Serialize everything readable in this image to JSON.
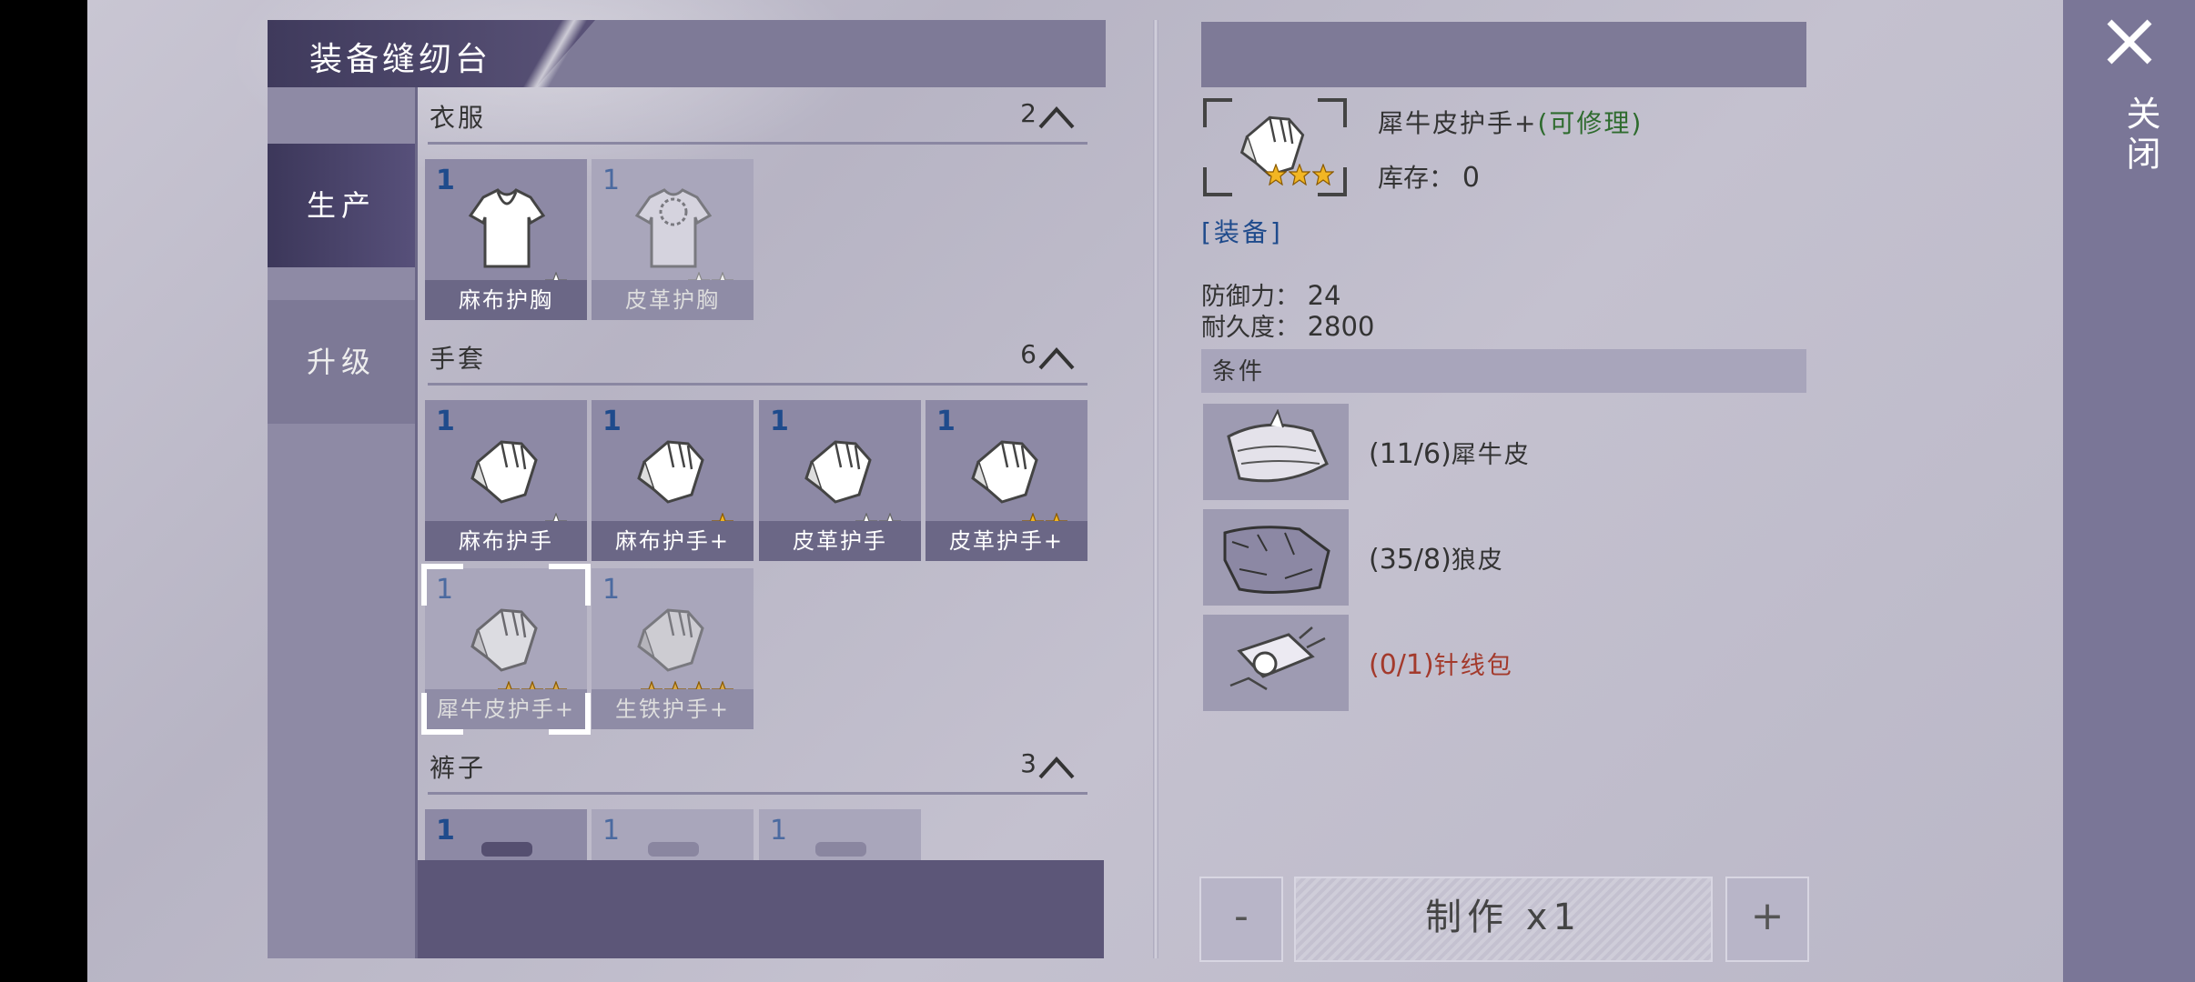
{
  "window": {
    "title": "装备缝纫台",
    "close_label": "关闭"
  },
  "side_tabs": [
    {
      "label": "生产",
      "active": true
    },
    {
      "label": "升级",
      "active": false
    }
  ],
  "categories": [
    {
      "name": "衣服",
      "count": "2",
      "items": [
        {
          "num": "1",
          "label": "麻布护胸",
          "stars": 1,
          "star_color": "white",
          "icon": "shirt-icon",
          "available": true
        },
        {
          "num": "1",
          "label": "皮革护胸",
          "stars": 2,
          "star_color": "white",
          "icon": "shirt-icon",
          "available": false
        }
      ]
    },
    {
      "name": "手套",
      "count": "6",
      "items": [
        {
          "num": "1",
          "label": "麻布护手",
          "stars": 1,
          "star_color": "white",
          "icon": "glove-icon",
          "available": true
        },
        {
          "num": "1",
          "label": "麻布护手+",
          "stars": 1,
          "star_color": "gold",
          "icon": "glove-icon",
          "available": true
        },
        {
          "num": "1",
          "label": "皮革护手",
          "stars": 2,
          "star_color": "white",
          "icon": "glove-icon",
          "available": true
        },
        {
          "num": "1",
          "label": "皮革护手+",
          "stars": 2,
          "star_color": "gold",
          "icon": "glove-icon",
          "available": true
        },
        {
          "num": "1",
          "label": "犀牛皮护手+",
          "stars": 3,
          "star_color": "gold",
          "icon": "glove-icon",
          "available": false,
          "selected": true
        },
        {
          "num": "1",
          "label": "生铁护手+",
          "stars": 4,
          "star_color": "gold",
          "icon": "glove-icon",
          "available": false
        }
      ]
    },
    {
      "name": "裤子",
      "count": "3",
      "items": [
        {
          "num": "1",
          "icon": "pants-icon",
          "available": true
        },
        {
          "num": "1",
          "icon": "pants-icon",
          "available": false
        },
        {
          "num": "1",
          "icon": "pants-icon",
          "available": false
        }
      ]
    }
  ],
  "detail": {
    "name": "犀牛皮护手+",
    "repairable_label": "(可修理)",
    "stock_label": "库存：",
    "stock_value": "0",
    "stars": 3,
    "tag": "[装备]",
    "defense_label": "防御力：",
    "defense_value": "24",
    "durability_label": "耐久度：",
    "durability_value": "2800",
    "conditions_label": "条件",
    "materials": [
      {
        "count": "(11/6)",
        "name": "犀牛皮",
        "enough": true,
        "icon": "rhino-hide-icon"
      },
      {
        "count": "(35/8)",
        "name": "狼皮",
        "enough": true,
        "icon": "wolf-pelt-icon"
      },
      {
        "count": "(0/1)",
        "name": "针线包",
        "enough": false,
        "icon": "sewing-kit-icon"
      }
    ]
  },
  "actions": {
    "minus": "-",
    "make": "制作 x1",
    "plus": "+"
  },
  "colors": {
    "star_gold": "#f2b623",
    "star_white": "#ffffff",
    "missing_red": "#a33a2c",
    "repairable_green": "#2e6b2e"
  }
}
